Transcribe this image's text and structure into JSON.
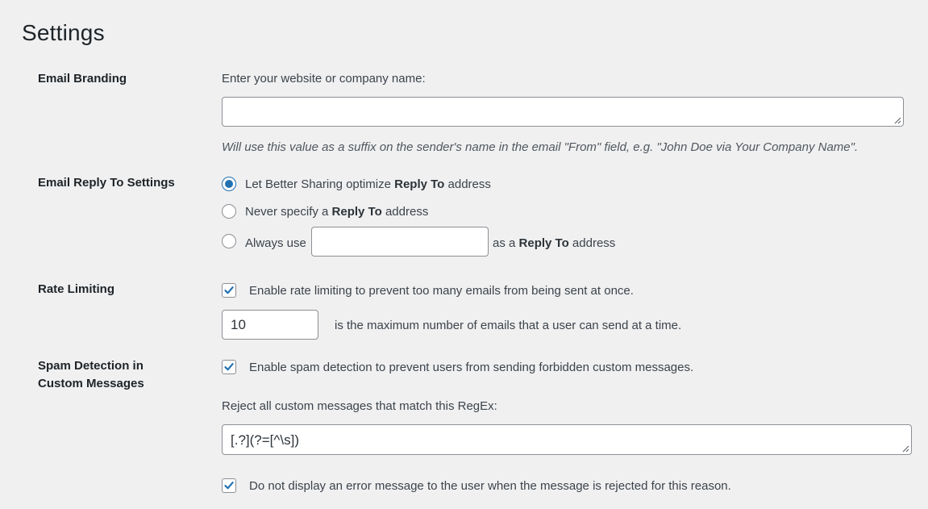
{
  "page": {
    "title": "Settings"
  },
  "email_branding": {
    "label": "Email Branding",
    "prompt": "Enter your website or company name:",
    "value": "",
    "description": "Will use this value as a suffix on the sender's name in the email \"From\" field, e.g. \"John Doe via Your Company Name\"."
  },
  "reply_to": {
    "label": "Email Reply To Settings",
    "options": [
      {
        "pre": "Let Better Sharing optimize ",
        "bold": "Reply To",
        "post": " address",
        "checked": true
      },
      {
        "pre": "Never specify a ",
        "bold": "Reply To",
        "post": " address",
        "checked": false
      },
      {
        "pre": "Always use",
        "bold": "Reply To",
        "post": " address",
        "between": "as a ",
        "checked": false
      }
    ],
    "custom_value": ""
  },
  "rate_limiting": {
    "label": "Rate Limiting",
    "enable_label": "Enable rate limiting to prevent too many emails from being sent at once.",
    "enabled": true,
    "max_value": "10",
    "max_label": "is the maximum number of emails that a user can send at a time."
  },
  "spam_detection": {
    "label_line1": "Spam Detection in",
    "label_line2": "Custom Messages",
    "enable_label": "Enable spam detection to prevent users from sending forbidden custom messages.",
    "enabled": true,
    "regex_prompt": "Reject all custom messages that match this RegEx:",
    "regex_value": "[.?](?=[^\\s])",
    "hide_error_label": "Do not display an error message to the user when the message is rejected for this reason.",
    "hide_error": true
  },
  "colors": {
    "accent": "#2271b1",
    "background": "#f0f0f1",
    "text": "#3c434a"
  }
}
